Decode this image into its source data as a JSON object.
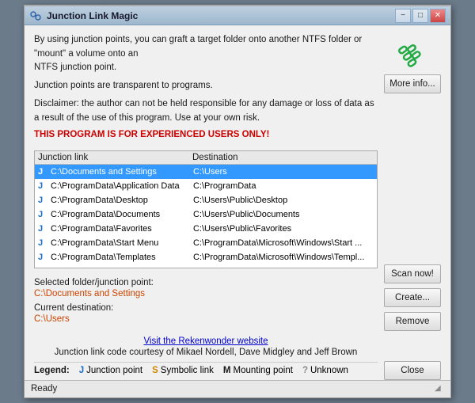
{
  "window": {
    "title": "Junction Link Magic",
    "min_btn": "−",
    "max_btn": "□",
    "close_btn": "✕"
  },
  "header": {
    "info_line1": "By using junction points, you can graft a target folder onto another NTFS folder or \"mount\" a volume onto an",
    "info_line2": "NTFS junction point.",
    "info_line3": "Junction points are transparent to programs.",
    "disclaimer": "Disclaimer: the author can not be held responsible for any damage or loss of data as a result of the use of this program.  Use at your own risk.",
    "warning": "THIS PROGRAM IS FOR EXPERIENCED USERS ONLY!"
  },
  "more_info_btn": "More info...",
  "scan_btn": "Scan now!",
  "create_btn": "Create...",
  "remove_btn": "Remove",
  "close_btn": "Close",
  "table": {
    "col_junction": "Junction link",
    "col_dest": "Destination",
    "rows": [
      {
        "marker": "J",
        "junction": "C:\\Documents and Settings",
        "dest": "C:\\Users",
        "selected": true
      },
      {
        "marker": "J",
        "junction": "C:\\ProgramData\\Application Data",
        "dest": "C:\\ProgramData",
        "selected": false
      },
      {
        "marker": "J",
        "junction": "C:\\ProgramData\\Desktop",
        "dest": "C:\\Users\\Public\\Desktop",
        "selected": false
      },
      {
        "marker": "J",
        "junction": "C:\\ProgramData\\Documents",
        "dest": "C:\\Users\\Public\\Documents",
        "selected": false
      },
      {
        "marker": "J",
        "junction": "C:\\ProgramData\\Favorites",
        "dest": "C:\\Users\\Public\\Favorites",
        "selected": false
      },
      {
        "marker": "J",
        "junction": "C:\\ProgramData\\Start Menu",
        "dest": "C:\\ProgramData\\Microsoft\\Windows\\Start ...",
        "selected": false
      },
      {
        "marker": "J",
        "junction": "C:\\ProgramData\\Templates",
        "dest": "C:\\ProgramData\\Microsoft\\Windows\\Templ...",
        "selected": false
      }
    ]
  },
  "selected_folder": {
    "label": "Selected folder/junction point:",
    "value": "C:\\Documents and Settings"
  },
  "current_dest": {
    "label": "Current destination:",
    "value": "C:\\Users"
  },
  "link": {
    "text": "Visit the Rekenwonder website"
  },
  "credits": {
    "text": "Junction link code courtesy of Mikael Nordell, Dave Midgley and Jeff Brown"
  },
  "legend": {
    "label": "Legend:",
    "items": [
      {
        "marker": "J",
        "text": "Junction point"
      },
      {
        "marker": "S",
        "text": "Symbolic link"
      },
      {
        "marker": "M",
        "text": "Mounting point"
      },
      {
        "marker": "?",
        "text": "Unknown"
      }
    ]
  },
  "status": {
    "text": "Ready"
  }
}
